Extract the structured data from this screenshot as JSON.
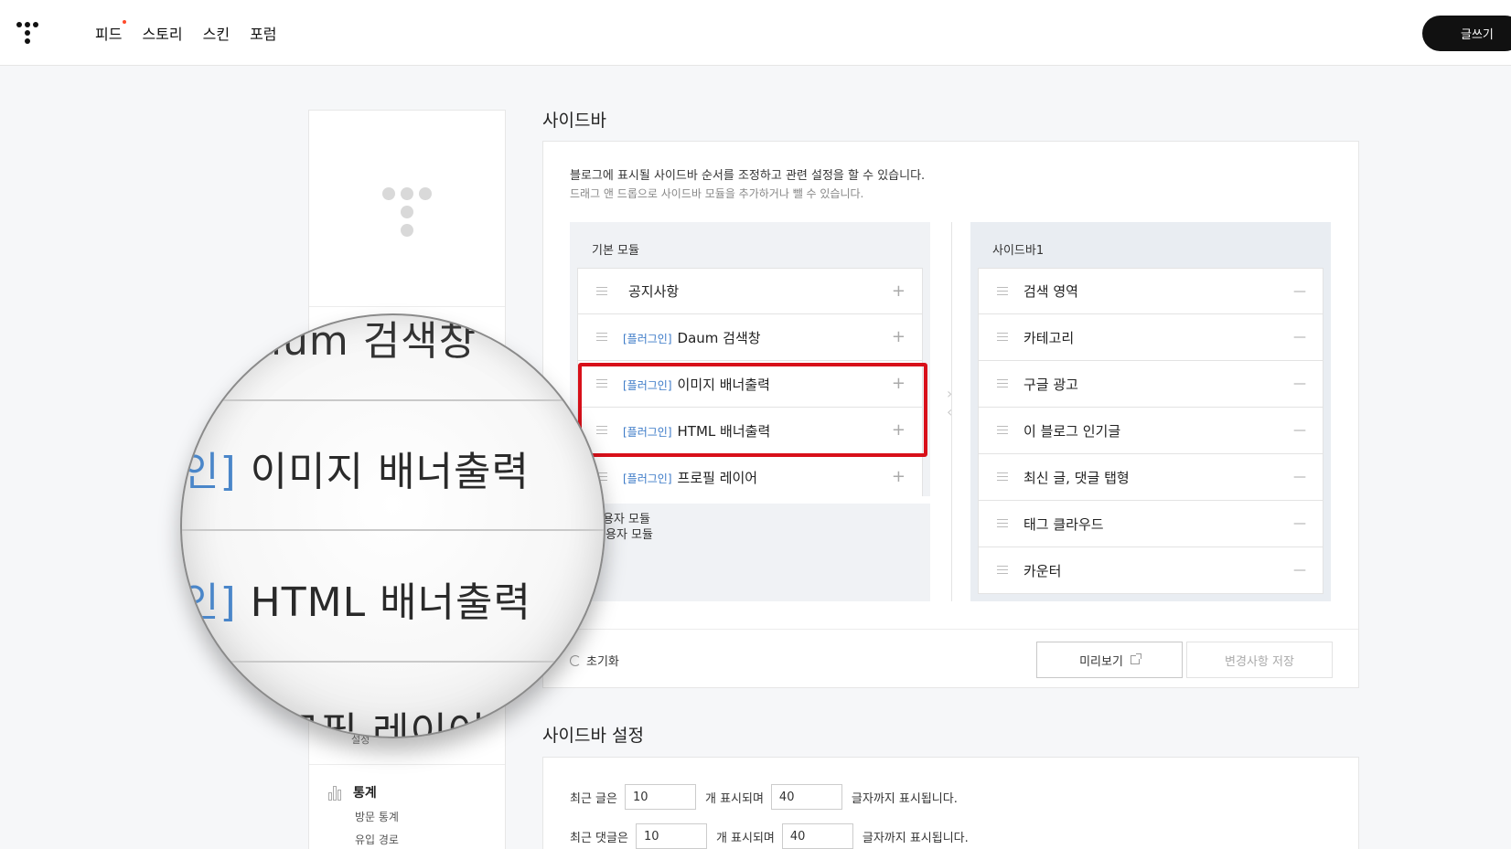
{
  "topbar": {
    "nav": [
      "피드",
      "스토리",
      "스킨",
      "포럼"
    ],
    "write_button": "글쓰기"
  },
  "leftcol": {
    "setting_fragment": "설정",
    "stats": {
      "title": "통계",
      "items": [
        "방문 통계",
        "유입 경로"
      ]
    }
  },
  "sidebar_section": {
    "title": "사이드바",
    "desc1": "블로그에 표시될 사이드바 순서를 조정하고 관련 설정을 할 수 있습니다.",
    "desc2": "드래그 앤 드롭으로 사이드바 모듈을 추가하거나 뺄 수 있습니다.",
    "basic_modules": {
      "title": "기본 모듈",
      "items": [
        {
          "tag": "",
          "label": "공지사항"
        },
        {
          "tag": "[플러그인]",
          "label": "Daum 검색창"
        },
        {
          "tag": "[플러그인]",
          "label": "이미지 배너출력"
        },
        {
          "tag": "[플러그인]",
          "label": "HTML 배너출력"
        },
        {
          "tag": "[플러그인]",
          "label": "프로필 레이어"
        }
      ],
      "add_symbol": "+"
    },
    "custom_modules_title": "사용자 모듈",
    "custom_modules_visible": "용자 모듈",
    "sidebar1": {
      "title": "사이드바1",
      "items": [
        "검색 영역",
        "카테고리",
        "구글 광고",
        "이 블로그 인기글",
        "최신 글, 댓글 탭형",
        "태그 클라우드",
        "카운터"
      ],
      "remove_symbol": "—"
    },
    "reset_label": "초기화",
    "preview_label": "미리보기",
    "save_label": "변경사항 저장"
  },
  "sidebar_settings": {
    "title": "사이드바 설정",
    "recent_posts": {
      "prefix": "최근 글은",
      "count": "10",
      "middle": "개 표시되며",
      "chars": "40",
      "suffix": "글자까지 표시됩니다."
    },
    "recent_comments": {
      "prefix": "최근 댓글은",
      "count": "10",
      "middle": "개 표시되며",
      "chars": "40",
      "suffix": "글자까지 표시됩니다."
    }
  },
  "magnifier": {
    "line1": "aum 검색창",
    "line2_tag": "인]",
    "line2": "이미지 배너출력",
    "line3_tag": "인]",
    "line3": "HTML 배너출력",
    "line4": "로필 레이어"
  },
  "colors": {
    "highlight": "#d8101a",
    "plugin_tag": "#3a79c7",
    "write_button_bg": "#111111"
  }
}
